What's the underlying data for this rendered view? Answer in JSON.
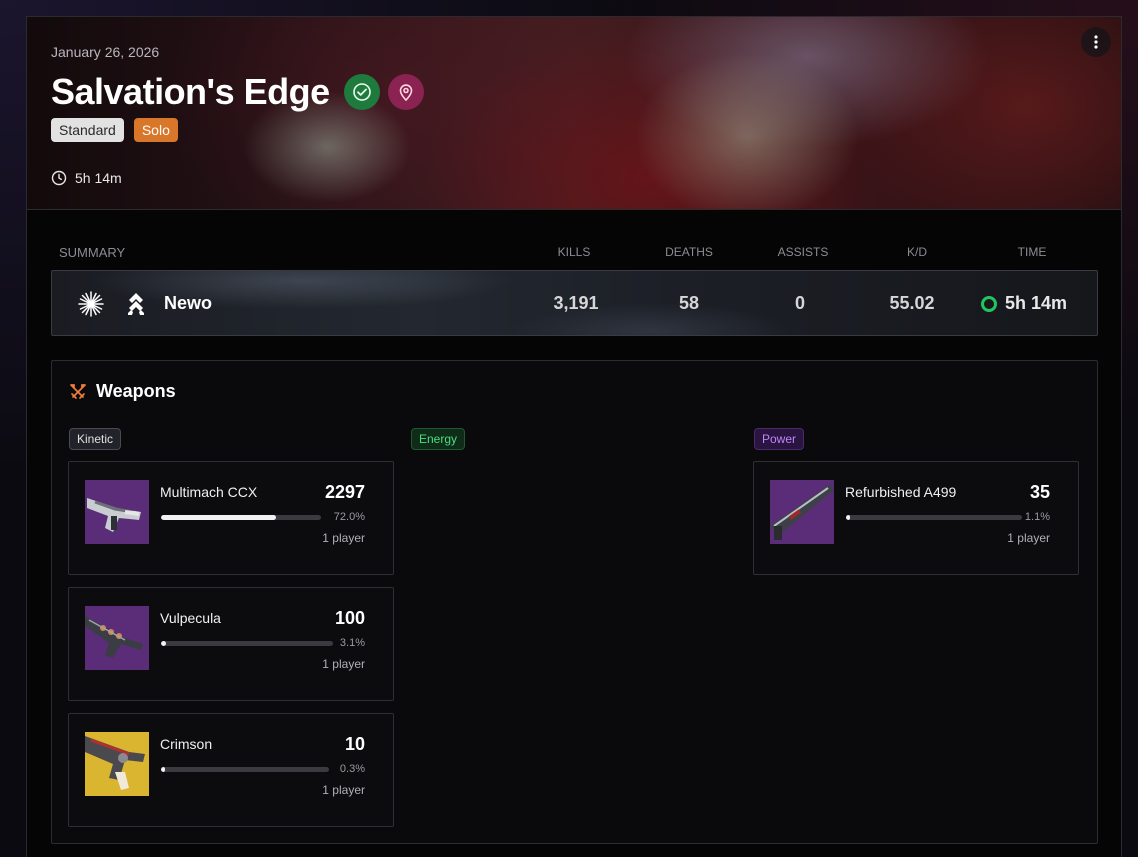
{
  "activity": {
    "date": "January 26, 2026",
    "title": "Salvation's Edge",
    "tags": [
      "Standard",
      "Solo"
    ],
    "duration": "5h 14m",
    "menu_icon": "kebab-menu-icon"
  },
  "summary": {
    "label": "SUMMARY",
    "columns": [
      "KILLS",
      "DEATHS",
      "ASSISTS",
      "K/D",
      "TIME"
    ],
    "player": {
      "name": "Newo",
      "kills": "3,191",
      "deaths": "58",
      "assists": "0",
      "kd": "55.02",
      "time": "5h 14m"
    }
  },
  "weapons": {
    "title": "Weapons",
    "slots": [
      "Kinetic",
      "Energy",
      "Power"
    ],
    "kinetic": [
      {
        "name": "Multimach CCX",
        "kills": "2297",
        "percent": "72.0%",
        "fraction": 0.72,
        "players": "1 player"
      },
      {
        "name": "Vulpecula",
        "kills": "100",
        "percent": "3.1%",
        "fraction": 0.031,
        "players": "1 player"
      },
      {
        "name": "Crimson",
        "kills": "10",
        "percent": "0.3%",
        "fraction": 0.003,
        "players": "1 player"
      }
    ],
    "power": [
      {
        "name": "Refurbished A499",
        "kills": "35",
        "percent": "1.1%",
        "fraction": 0.011,
        "players": "1 player"
      }
    ]
  },
  "colors": {
    "accent_green": "#22c55e",
    "solo_tag": "#d8772a",
    "energy": "#4ade80",
    "power": "#c084fc"
  }
}
